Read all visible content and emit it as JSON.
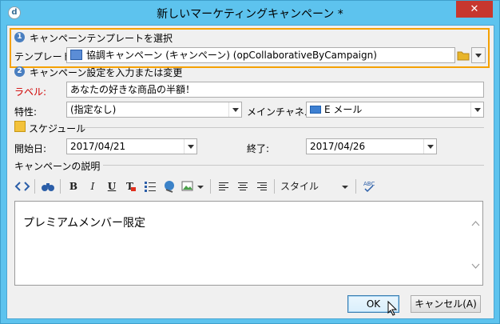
{
  "window": {
    "title": "新しいマーケティングキャンペーン *",
    "close_label": "✕"
  },
  "template_section": {
    "step_number": "1",
    "heading": "キャンペーンテンプレートを選択",
    "label": "テンプレート:",
    "value": "協調キャンペーン (キャンペーン) (opCollaborativeByCampaign)"
  },
  "settings_section": {
    "step_number": "2",
    "heading": "キャンペーン設定を入力または変更",
    "label_field": {
      "label": "ラベル:",
      "value": "あなたの好きな商品の半額！"
    },
    "nature_field": {
      "label": "特性:",
      "value": "(指定なし)"
    },
    "channel_field": {
      "label": "メインチャネル:",
      "value": "E メール"
    }
  },
  "schedule": {
    "heading": "スケジュール",
    "start_label": "開始日:",
    "start_value": "2017/04/21",
    "end_label": "終了:",
    "end_value": "2017/04/26"
  },
  "description": {
    "heading": "キャンペーンの説明",
    "toolbar": {
      "bold": "B",
      "italic": "I",
      "underline": "U",
      "style_label": "スタイル"
    },
    "content": "プレミアムメンバー限定"
  },
  "buttons": {
    "ok": "OK",
    "cancel": "キャンセル(A)"
  },
  "colors": {
    "titlebar": "#5dc3ee",
    "highlight": "#f5a100",
    "close": "#c7372e",
    "required_label": "#d00000"
  }
}
